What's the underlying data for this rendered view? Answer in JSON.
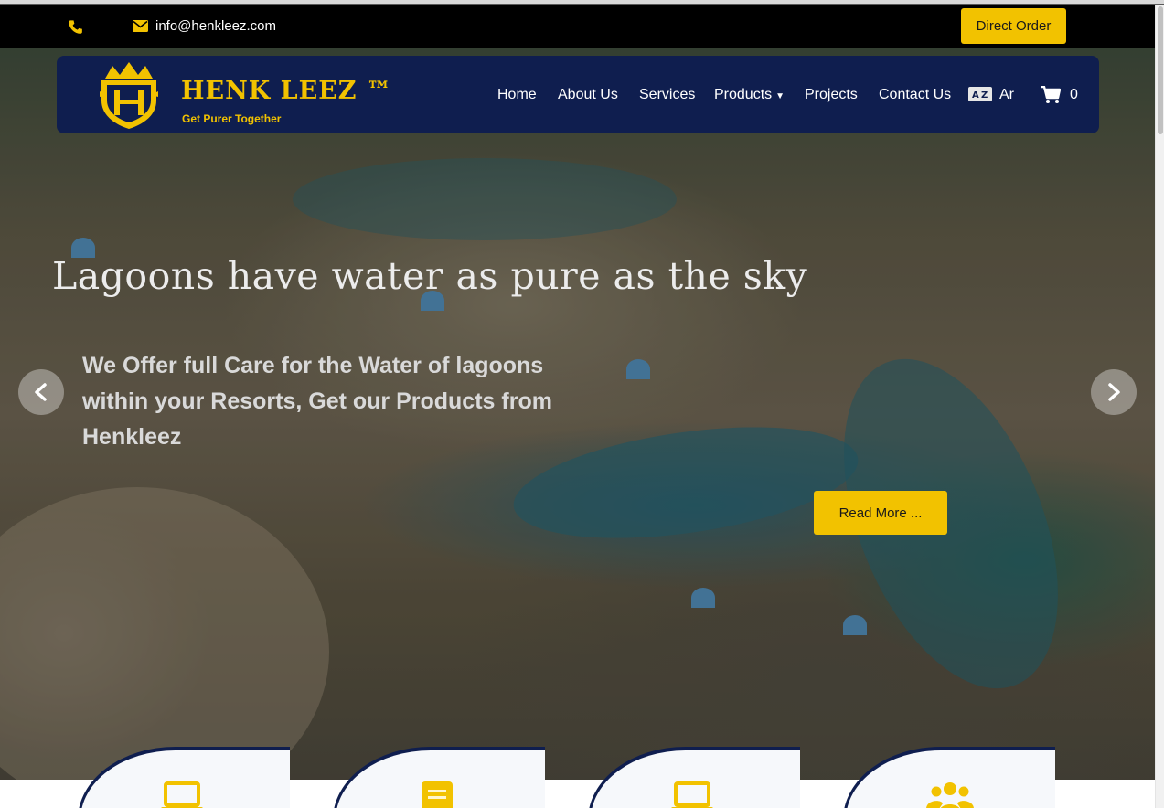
{
  "topbar": {
    "phone_icon": "phone-icon",
    "mail_icon": "envelope-icon",
    "email": "info@henkleez.com",
    "direct_order_label": "Direct Order"
  },
  "brand": {
    "name": "HENK LEEZ ™",
    "tagline": "Get Purer Together",
    "logo_icon": "crown-shield-logo"
  },
  "nav": {
    "items": [
      {
        "label": "Home"
      },
      {
        "label": "About Us"
      },
      {
        "label": "Services"
      },
      {
        "label": "Products",
        "has_dropdown": true
      },
      {
        "label": "Projects"
      },
      {
        "label": "Contact Us"
      }
    ],
    "language_label": "Ar",
    "language_icon": "translate-icon",
    "cart_icon": "cart-icon",
    "cart_count": "0"
  },
  "hero": {
    "headline": "Lagoons have water as pure as the sky",
    "subtext": "We Offer full Care for the Water of lagoons within your Resorts, Get our Products from Henkleez",
    "read_more_label": "Read More ...",
    "prev_icon": "chevron-left-icon",
    "next_icon": "chevron-right-icon"
  },
  "feature_cards": [
    {
      "icon": "laptop-icon"
    },
    {
      "icon": "document-icon"
    },
    {
      "icon": "laptop-icon"
    },
    {
      "icon": "users-icon"
    }
  ],
  "colors": {
    "accent": "#f2c200",
    "navy": "#0f1e4f",
    "topbar": "#000000"
  }
}
